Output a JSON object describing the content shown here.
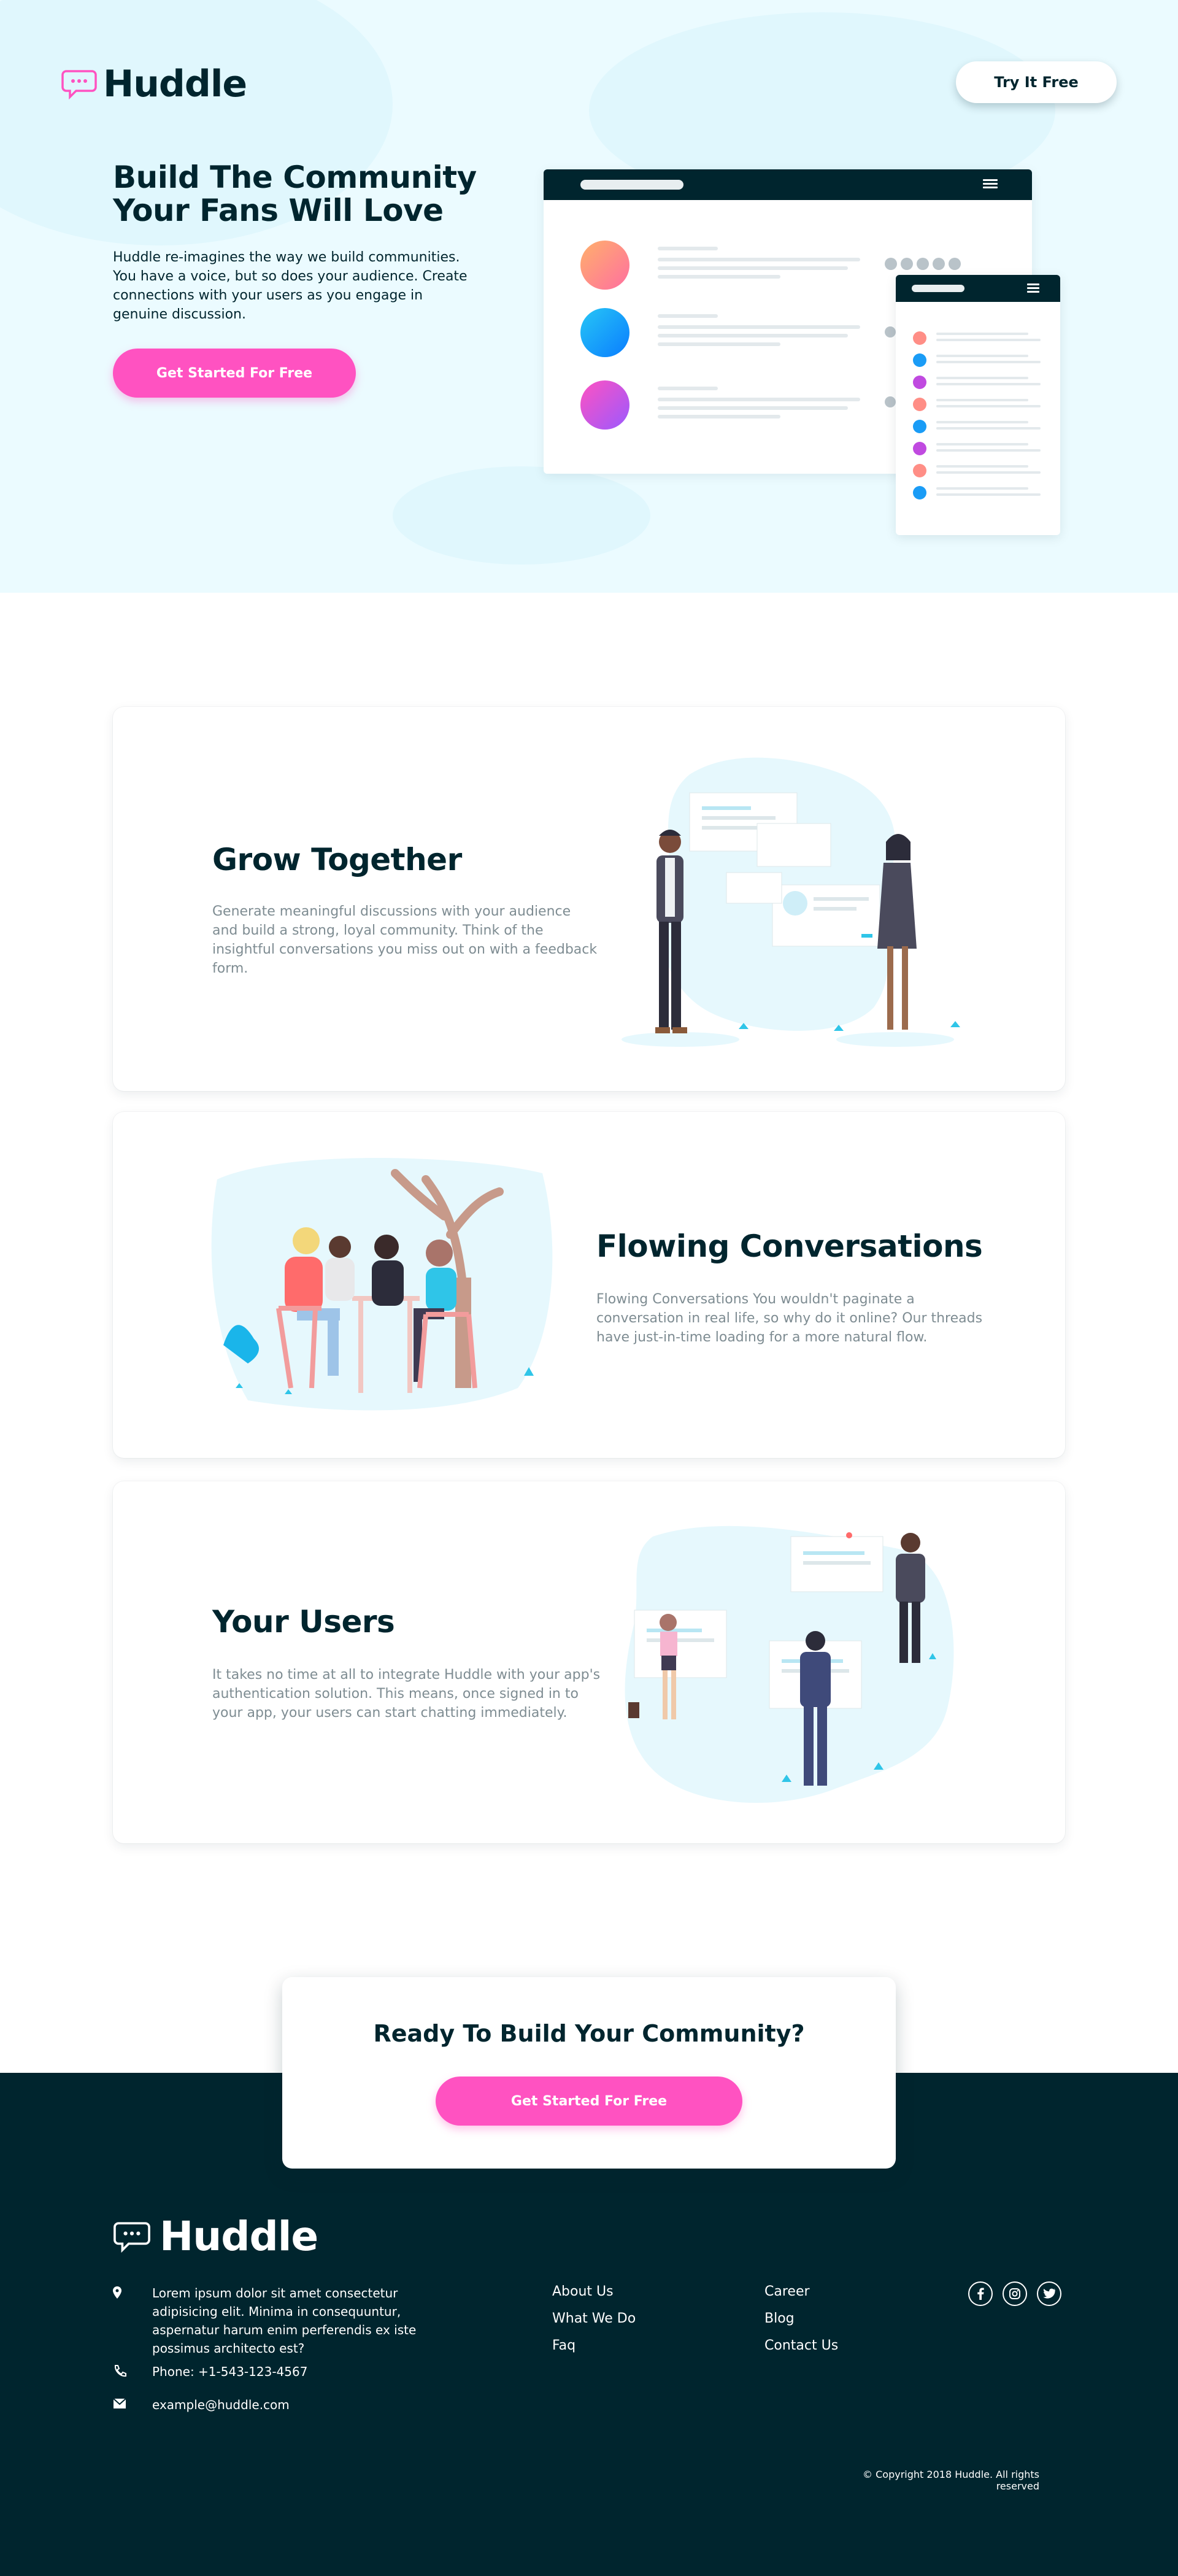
{
  "brand": {
    "name": "Huddle",
    "accent": "#ff52c1",
    "dark": "#00252e",
    "hero_bg": "#ebfbff"
  },
  "header": {
    "try_button": "Try It Free"
  },
  "hero": {
    "title_line1": "Build The Community",
    "title_line2": "Your Fans Will Love",
    "text": "Huddle re-imagines the way we build communities. You have a voice, but so does your audience. Create connections with your users as you engage in genuine discussion.",
    "cta": "Get Started For Free"
  },
  "features": [
    {
      "title": "Grow Together",
      "text": "Generate meaningful discussions with your audience and build a strong, loyal community. Think of the insightful conversations you miss out on with a feedback form."
    },
    {
      "title": "Flowing Conversations",
      "text": "Flowing Conversations You wouldn't paginate a conversation in real life, so why do it online? Our threads have just-in-time loading for a more natural flow."
    },
    {
      "title": "Your Users",
      "text": "It takes no time at all to integrate Huddle with your app's authentication solution. This means, once signed in to your app, your users can start chatting immediately."
    }
  ],
  "cta_box": {
    "title": "Ready To Build Your Community?",
    "button": "Get Started For Free"
  },
  "footer": {
    "address": "Lorem ipsum dolor sit amet consectetur adipisicing elit. Minima in consequuntur, aspernatur harum enim perferendis ex iste possimus architecto est?",
    "phone": "Phone: +1-543-123-4567",
    "email": "example@huddle.com",
    "links_col1": [
      "About Us",
      "What We Do",
      "Faq"
    ],
    "links_col2": [
      "Career",
      "Blog",
      "Contact Us"
    ],
    "social": [
      "facebook-icon",
      "instagram-icon",
      "twitter-icon"
    ],
    "copyright": "© Copyright 2018 Huddle. All rights reserved"
  }
}
